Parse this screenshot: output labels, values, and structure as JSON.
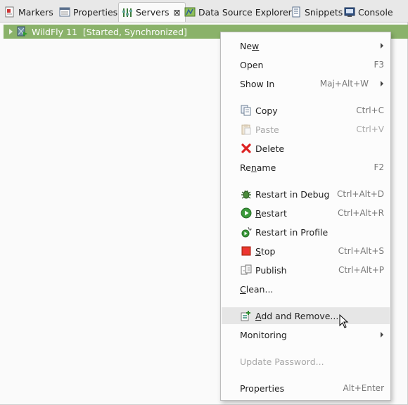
{
  "tabs": [
    {
      "label": "Markers",
      "icon": "markers-icon"
    },
    {
      "label": "Properties",
      "icon": "properties-icon"
    },
    {
      "label": "Servers",
      "icon": "servers-icon",
      "active": true
    },
    {
      "label": "Data Source Explorer",
      "icon": "data-source-icon"
    },
    {
      "label": "Snippets",
      "icon": "snippets-icon"
    },
    {
      "label": "Console",
      "icon": "console-icon"
    }
  ],
  "server": {
    "name": "WildFly 11",
    "status": "[Started, Synchronized]",
    "highlight_color": "#8ab26a"
  },
  "menu": {
    "new": {
      "pre": "Ne",
      "mn": "w",
      "post": ""
    },
    "open": {
      "label": "Open",
      "accel": "F3"
    },
    "show_in": {
      "label": "Show In",
      "accel": "Maj+Alt+W"
    },
    "copy": {
      "label": "Copy",
      "accel": "Ctrl+C"
    },
    "paste": {
      "label": "Paste",
      "accel": "Ctrl+V"
    },
    "delete": {
      "label": "Delete"
    },
    "rename": {
      "pre": "Re",
      "mn": "n",
      "post": "ame",
      "accel": "F2"
    },
    "restart_debug": {
      "label": "Restart in Debug",
      "accel": "Ctrl+Alt+D"
    },
    "restart": {
      "pre": "",
      "mn": "R",
      "post": "estart",
      "accel": "Ctrl+Alt+R"
    },
    "restart_profile": {
      "label": "Restart in Profile"
    },
    "stop": {
      "pre": "",
      "mn": "S",
      "post": "top",
      "accel": "Ctrl+Alt+S"
    },
    "publish": {
      "label": "Publish",
      "accel": "Ctrl+Alt+P"
    },
    "clean": {
      "pre": "",
      "mn": "C",
      "post": "lean...",
      "accel": ""
    },
    "add_remove": {
      "pre": "",
      "mn": "A",
      "post": "dd and Remove..."
    },
    "monitoring": {
      "label": "Monitoring"
    },
    "update_password": {
      "label": "Update Password..."
    },
    "properties": {
      "label": "Properties",
      "accel": "Alt+Enter"
    }
  }
}
